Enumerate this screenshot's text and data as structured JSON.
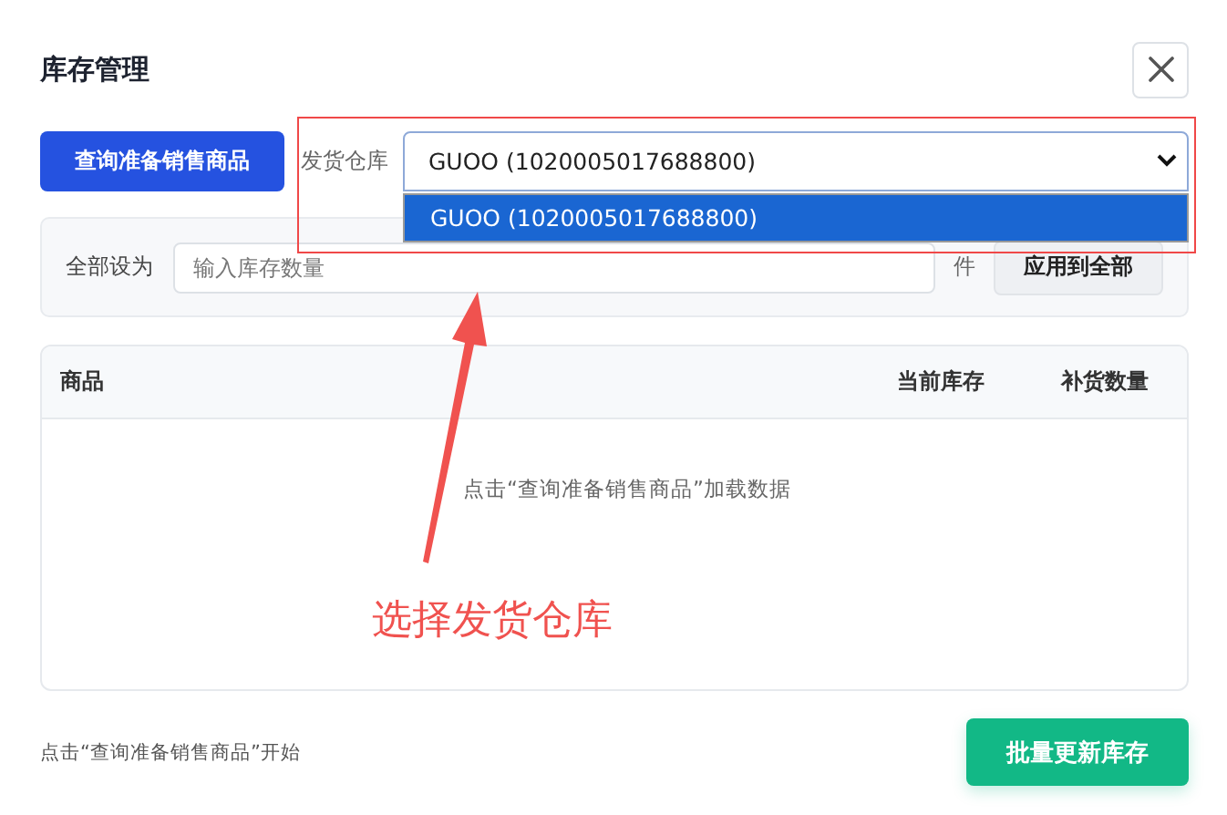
{
  "dialog": {
    "title": "库存管理"
  },
  "toolbar": {
    "query_button": "查询准备销售商品",
    "warehouse": {
      "label": "发货仓库",
      "value": "GUOO (1020005017688800)",
      "expanded": true,
      "options": [
        {
          "label": "GUOO (1020005017688800)",
          "selected": true
        }
      ]
    }
  },
  "set_all": {
    "label": "全部设为",
    "placeholder": "输入库存数量",
    "unit": "件",
    "button": "应用到全部"
  },
  "table": {
    "columns": [
      "商品",
      "当前库存",
      "补货数量"
    ],
    "empty_text": "点击“查询准备销售商品”加载数据"
  },
  "footer": {
    "hint": "点击“查询准备销售商品”开始",
    "button": "批量更新库存"
  },
  "annotation": {
    "text": "选择发货仓库"
  }
}
